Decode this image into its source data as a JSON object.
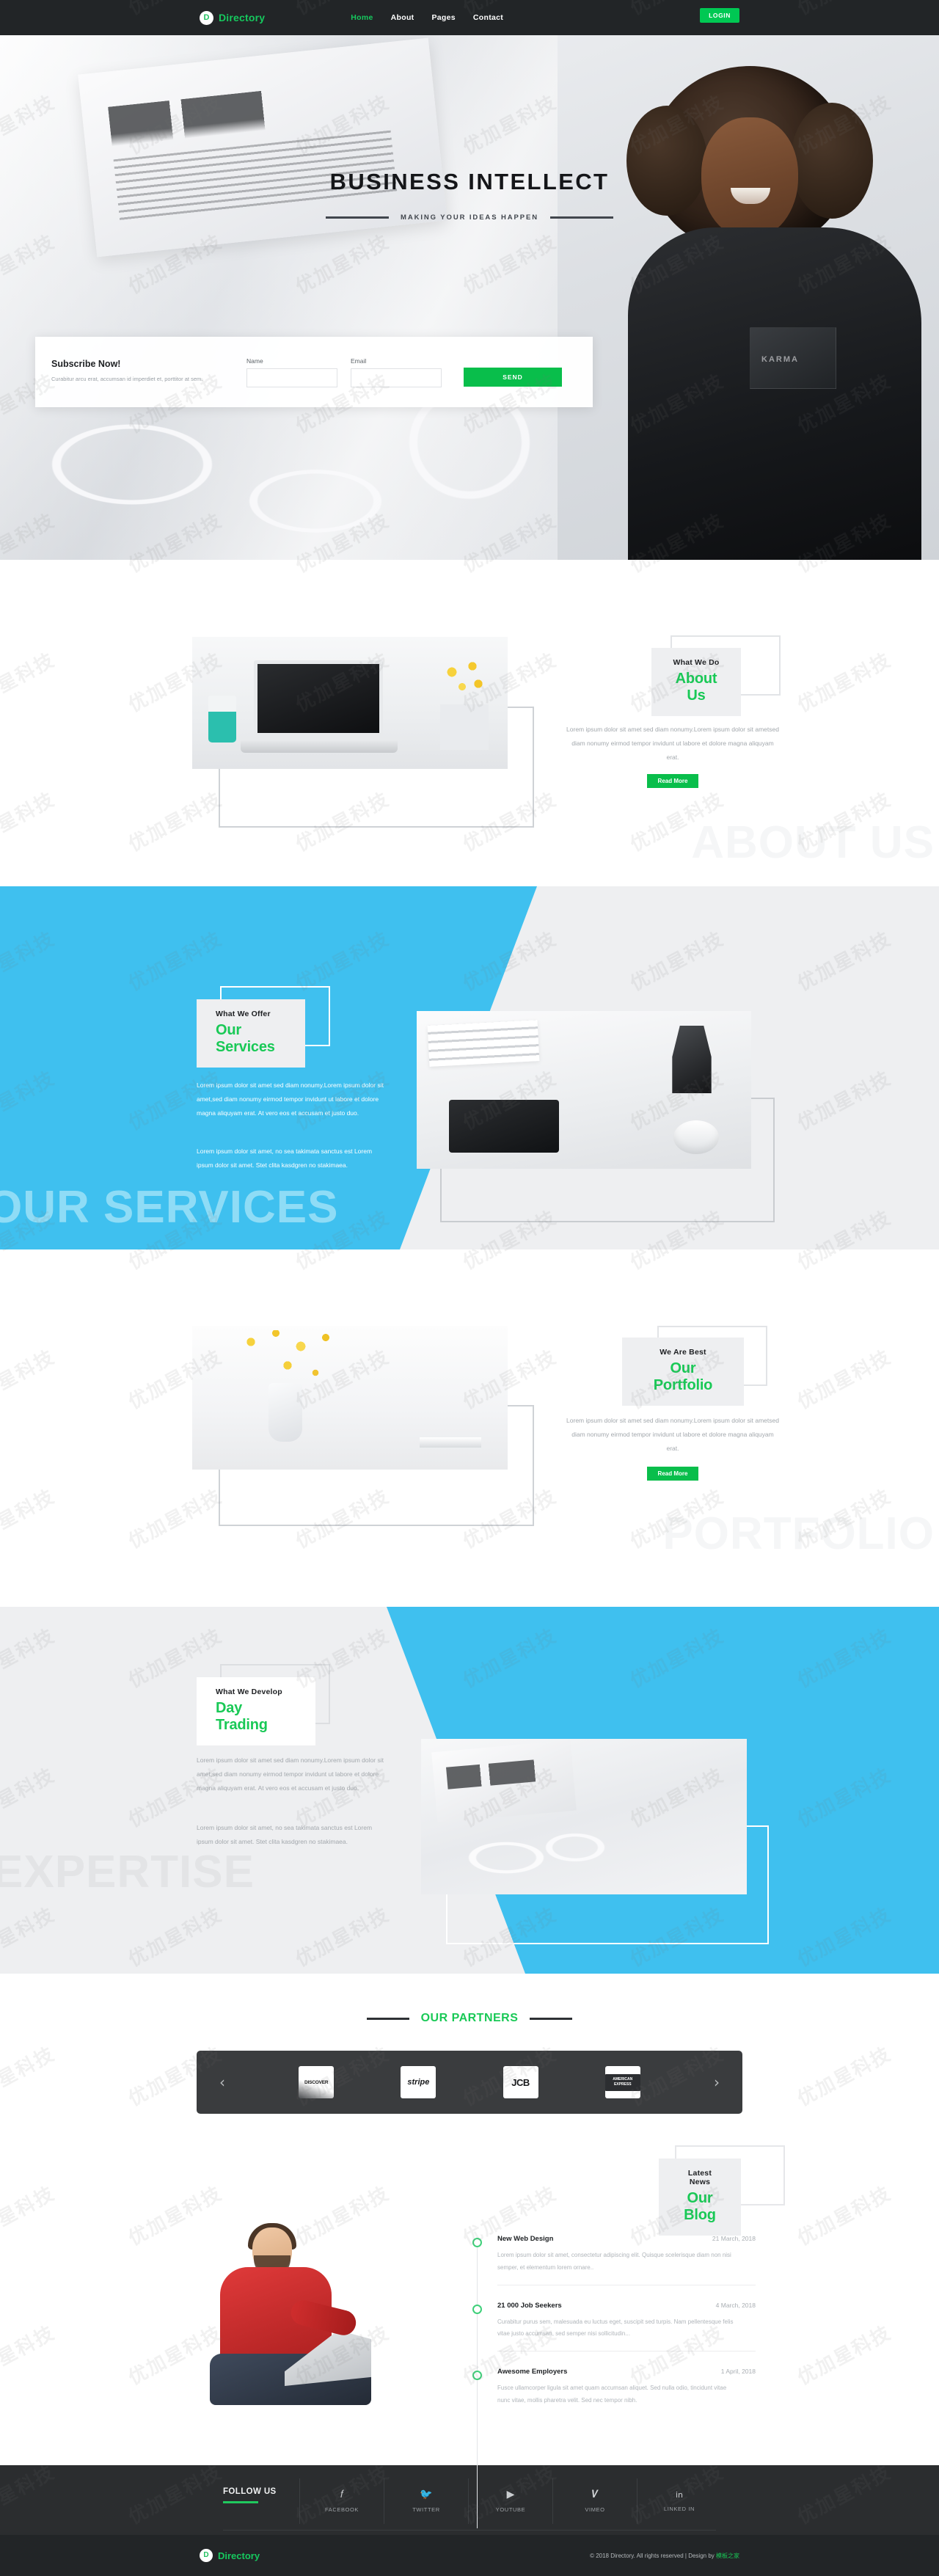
{
  "nav": {
    "brand_mark": "D",
    "brand": "Directory",
    "links": [
      {
        "label": "Home",
        "active": true
      },
      {
        "label": "About",
        "active": false
      },
      {
        "label": "Pages",
        "active": false
      },
      {
        "label": "Contact",
        "active": false
      }
    ],
    "login": "LOGIN"
  },
  "hero": {
    "title": "BUSINESS INTELLECT",
    "subtitle": "MAKING YOUR IDEAS HAPPEN",
    "person_garment_text": "KARMA"
  },
  "subscribe": {
    "title": "Subscribe Now!",
    "description": "Curabitur arcu erat, accumsan id imperdiet et, porttitor at sem.",
    "name_label": "Name",
    "name_value": "",
    "name_placeholder": "",
    "email_label": "Email",
    "email_value": "",
    "email_placeholder": "",
    "send_label": "SEND"
  },
  "about": {
    "kicker": "What We Do",
    "title": "About Us",
    "body": "Lorem ipsum dolor sit amet sed diam nonumy.Lorem ipsum dolor sit ametsed diam nonumy eirmod tempor invidunt ut labore et dolore magna aliquyam erat.",
    "read_more": "Read More",
    "watermark": "ABOUT US"
  },
  "services": {
    "kicker": "What We Offer",
    "title": "Our Services",
    "body1": "Lorem ipsum dolor sit amet sed diam nonumy.Lorem ipsum dolor sit amet,sed diam nonumy eirmod tempor invidunt ut labore et dolore magna aliquyam erat. At vero eos et accusam et justo duo.",
    "body2": "Lorem ipsum dolor sit amet, no sea takimata sanctus est Lorem ipsum dolor sit amet. Stet clita kasdgren no stakimaea.",
    "watermark": "OUR SERVICES",
    "accent": "#3fc0ef"
  },
  "portfolio": {
    "kicker": "We Are Best",
    "title": "Our Portfolio",
    "body": "Lorem ipsum dolor sit amet sed diam nonumy.Lorem ipsum dolor sit ametsed diam nonumy eirmod tempor invidunt ut labore et dolore magna aliquyam erat.",
    "read_more": "Read More",
    "watermark": "PORTFOLIO"
  },
  "expertise": {
    "kicker": "What We Develop",
    "title": "Day Trading",
    "body1": "Lorem ipsum dolor sit amet sed diam nonumy.Lorem ipsum dolor sit amet,sed diam nonumy eirmod tempor invidunt ut labore et dolore magna aliquyam erat. At vero eos et accusam et justo duo.",
    "body2": "Lorem ipsum dolor sit amet, no sea takimata sanctus est Lorem ipsum dolor sit amet. Stet clita kasdgren no stakimaea.",
    "watermark": "EXPERTISE"
  },
  "partners": {
    "heading": "OUR PARTNERS",
    "prev_icon": "chevron-left",
    "next_icon": "chevron-right",
    "logos": [
      {
        "name": "DISCOVER"
      },
      {
        "name": "stripe"
      },
      {
        "name": "JCB"
      },
      {
        "name": "AMERICAN EXPRESS"
      }
    ]
  },
  "blog": {
    "kicker": "Latest News",
    "title": "Our Blog",
    "posts": [
      {
        "title": "New Web Design",
        "date": "21 March, 2018",
        "text": "Lorem ipsum dolor sit amet, consectetur adipiscing elit. Quisque scelerisque diam non nisi semper, et elementum lorem ornare.."
      },
      {
        "title": "21 000 Job Seekers",
        "date": "4 March, 2018",
        "text": "Curabitur purus sem, malesuada eu luctus eget, suscipit sed turpis. Nam pellentesque felis vitae justo accumsan, sed semper nisi sollicitudin..."
      },
      {
        "title": "Awesome Employers",
        "date": "1 April, 2018",
        "text": "Fusce ullamcorper ligula sit amet quam accumsan aliquet. Sed nulla odio, tincidunt vitae nunc vitae, mollis pharetra velit. Sed nec tempor nibh."
      }
    ]
  },
  "footer": {
    "follow_label": "FOLLOW US",
    "socials": [
      {
        "label": "FACEBOOK",
        "icon": "facebook-icon",
        "glyph": "f"
      },
      {
        "label": "TWITTER",
        "icon": "twitter-icon",
        "glyph": "ᴛ"
      },
      {
        "label": "YOUTUBE",
        "icon": "youtube-icon",
        "glyph": "▶"
      },
      {
        "label": "VIMEO",
        "icon": "vimeo-icon",
        "glyph": "V"
      },
      {
        "label": "LINKED IN",
        "icon": "linkedin-icon",
        "glyph": "in"
      }
    ],
    "brand_mark": "D",
    "brand": "Directory",
    "copyright": "© 2018 Directory. All rights reserved | Design by ",
    "design_by": "模板之家"
  },
  "watermark": {
    "text": "优加星科技"
  }
}
